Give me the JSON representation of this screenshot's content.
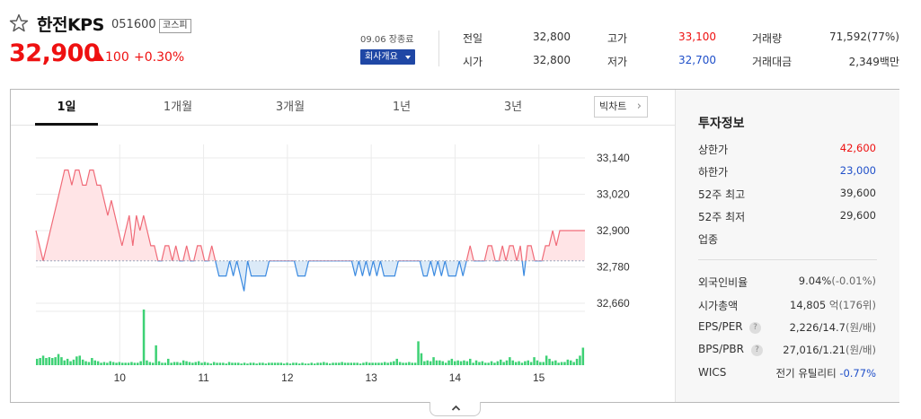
{
  "header": {
    "name": "한전KPS",
    "code": "051600",
    "market": "코스피",
    "price": "32,900",
    "change": "100",
    "change_rate": "+0.30%",
    "close_time": "09.06 장종료",
    "company_button": "회사개요"
  },
  "quotes": {
    "prev_close_label": "전일",
    "prev_close": "32,800",
    "open_label": "시가",
    "open": "32,800",
    "high_label": "고가",
    "high": "33,100",
    "low_label": "저가",
    "low": "32,700",
    "volume_label": "거래량",
    "volume": "71,592(77%)",
    "amount_label": "거래대금",
    "amount": "2,349백만"
  },
  "tabs": [
    "1일",
    "1개월",
    "3개월",
    "1년",
    "3년"
  ],
  "big_chart_button": "빅차트",
  "invest": {
    "title": "투자정보",
    "upper_limit_label": "상한가",
    "upper_limit": "42,600",
    "lower_limit_label": "하한가",
    "lower_limit": "23,000",
    "high52_label": "52주 최고",
    "high52": "39,600",
    "low52_label": "52주 최저",
    "low52": "29,600",
    "sector_label": "업종",
    "foreign_label": "외국인비율",
    "foreign": "9.04%",
    "foreign_change": "(-0.01%)",
    "market_cap_label": "시가총액",
    "market_cap": "14,805",
    "market_cap_unit": "억(176위)",
    "eps_per_label": "EPS/PER",
    "eps_per": "2,226/14.7",
    "eps_per_unit": "(원/배)",
    "bps_pbr_label": "BPS/PBR",
    "bps_pbr": "27,016/1.21",
    "bps_pbr_unit": "(원/배)",
    "wics_label": "WICS",
    "wics": "전기 유틸리티",
    "wics_change": "-0.77%",
    "help_glyph": "?"
  },
  "colors": {
    "up": "#e11111",
    "down": "#1f4fc9",
    "volume": "#3dd174",
    "up_fill": "#ffe4e6",
    "down_fill": "#dbeaf8"
  },
  "chart_data": {
    "type": "line",
    "title": "",
    "y_ticks": [
      "33,140",
      "33,020",
      "32,900",
      "32,780",
      "32,660"
    ],
    "y_tick_values": [
      33140,
      33020,
      32900,
      32780,
      32660
    ],
    "x_ticks": [
      "10",
      "11",
      "12",
      "13",
      "14",
      "15"
    ],
    "x_tick_hours": [
      10,
      11,
      12,
      13,
      14,
      15
    ],
    "ylim": [
      32660,
      33140
    ],
    "baseline": 32800,
    "x_start_hour": 9.0,
    "x_end_hour": 15.55,
    "price": [
      32900,
      32850,
      32800,
      32850,
      32900,
      32950,
      33000,
      33050,
      33100,
      33100,
      33050,
      33100,
      33100,
      33050,
      33050,
      33100,
      33100,
      33050,
      33050,
      33000,
      32950,
      33000,
      32950,
      32900,
      32850,
      32900,
      32950,
      32850,
      32950,
      32900,
      32950,
      32900,
      32850,
      32850,
      32800,
      32800,
      32850,
      32850,
      32800,
      32850,
      32800,
      32800,
      32850,
      32800,
      32800,
      32850,
      32850,
      32800,
      32800,
      32850,
      32800,
      32750,
      32750,
      32750,
      32800,
      32750,
      32800,
      32750,
      32700,
      32800,
      32750,
      32750,
      32750,
      32750,
      32750,
      32800,
      32800,
      32800,
      32800,
      32800,
      32800,
      32800,
      32800,
      32750,
      32750,
      32750,
      32800,
      32800,
      32800,
      32800,
      32800,
      32800,
      32800,
      32800,
      32800,
      32800,
      32800,
      32800,
      32800,
      32750,
      32800,
      32750,
      32800,
      32750,
      32800,
      32750,
      32800,
      32750,
      32750,
      32750,
      32750,
      32800,
      32800,
      32800,
      32800,
      32800,
      32800,
      32800,
      32750,
      32750,
      32800,
      32750,
      32800,
      32750,
      32800,
      32750,
      32750,
      32750,
      32800,
      32750,
      32800,
      32850,
      32800,
      32800,
      32800,
      32800,
      32850,
      32850,
      32800,
      32800,
      32850,
      32800,
      32850,
      32850,
      32800,
      32850,
      32750,
      32850,
      32850,
      32800,
      32800,
      32800,
      32850,
      32850,
      32900,
      32850,
      32900,
      32900,
      32900,
      32900,
      32900,
      32900,
      32900,
      32900
    ],
    "volume": [
      8,
      9,
      12,
      9,
      10,
      9,
      10,
      14,
      10,
      6,
      8,
      5,
      7,
      11,
      12,
      7,
      5,
      4,
      9,
      6,
      5,
      3,
      4,
      3,
      5,
      4,
      3,
      4,
      3,
      3,
      3,
      4,
      3,
      3,
      5,
      70,
      6,
      4,
      3,
      25,
      5,
      3,
      3,
      8,
      3,
      4,
      4,
      3,
      6,
      5,
      4,
      3,
      4,
      5,
      3,
      4,
      3,
      2,
      4,
      3,
      3,
      3,
      2,
      4,
      3,
      3,
      3,
      2,
      3,
      2,
      3,
      3,
      2,
      3,
      3,
      2,
      3,
      3,
      3,
      3,
      3,
      2,
      3,
      2,
      3,
      3,
      2,
      3,
      2,
      2,
      3,
      2,
      3,
      3,
      4,
      3,
      2,
      3,
      3,
      3,
      4,
      3,
      3,
      3,
      3,
      3,
      2,
      3,
      4,
      3,
      3,
      3,
      3,
      3,
      4,
      3,
      4,
      5,
      8,
      4,
      3,
      3,
      4,
      3,
      3,
      30,
      15,
      5,
      6,
      5,
      10,
      6,
      6,
      5,
      3,
      6,
      8,
      5,
      6,
      5,
      6,
      5,
      8,
      3,
      6,
      4,
      5,
      3,
      3,
      5,
      3,
      5,
      7,
      4,
      6,
      10,
      6,
      4,
      5,
      3,
      5,
      6,
      4,
      10,
      6,
      4,
      4,
      12,
      8,
      5,
      6,
      3,
      4,
      4,
      7,
      6,
      4,
      8,
      12,
      22
    ]
  }
}
